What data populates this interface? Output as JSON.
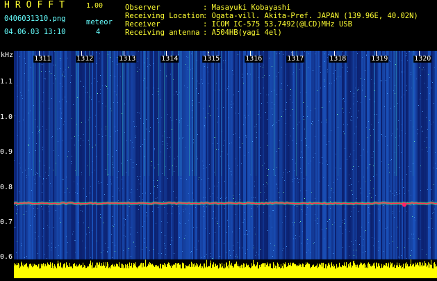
{
  "header": {
    "app_name": "HROFFT",
    "app_version": "1.00",
    "file_name": "0406031310.png",
    "datetime": "04.06.03 13:10",
    "meteor_label": "meteor",
    "meteor_count": "4",
    "info": [
      {
        "label": "Observer",
        "value": ": Masayuki Kobayashi"
      },
      {
        "label": "Receiving Location",
        "value": ": Ogata-vill. Akita-Pref. JAPAN (139.96E, 40.02N)"
      },
      {
        "label": "Receiver",
        "value": ": ICOM IC-575 53.7492(@LCD)MHz USB"
      },
      {
        "label": "Receiving antenna",
        "value": ": A504HB(yagi 4el)"
      }
    ]
  },
  "spectrogram": {
    "y_unit": "kHz",
    "y_ticks": [
      "1.1",
      "1.0",
      "0.9",
      "0.8",
      "0.7",
      "0.6"
    ],
    "x_ticks": [
      "1311",
      "1312",
      "1313",
      "1314",
      "1315",
      "1316",
      "1317",
      "1318",
      "1319",
      "1320"
    ],
    "signal_freq_khz": 0.755,
    "colors": {
      "background": "#0b1e6b",
      "noise": "#1f5fd0",
      "signal": "#ff3355",
      "amplitude": "#ffff00"
    }
  }
}
